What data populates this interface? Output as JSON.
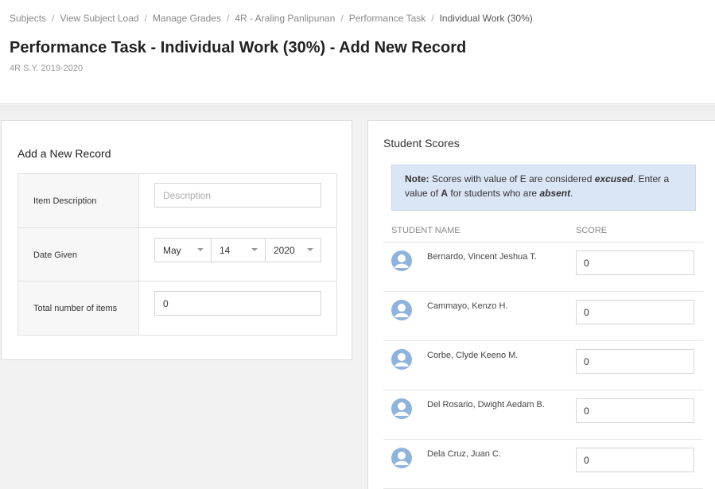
{
  "breadcrumb": [
    {
      "label": "Subjects"
    },
    {
      "label": "View Subject Load"
    },
    {
      "label": "Manage Grades"
    },
    {
      "label": "4R - Araling Panlipunan"
    },
    {
      "label": "Performance Task"
    },
    {
      "label": "Individual Work (30%)"
    }
  ],
  "page": {
    "title": "Performance Task - Individual Work (30%) - Add New Record",
    "subtitle": "4R S.Y. 2019-2020"
  },
  "form": {
    "title": "Add a New Record",
    "item_description": {
      "label": "Item Description",
      "placeholder": "Description",
      "value": ""
    },
    "date_given": {
      "label": "Date Given",
      "month": "May",
      "day": "14",
      "year": "2020"
    },
    "total_items": {
      "label": "Total number of items",
      "value": "0"
    }
  },
  "scores": {
    "title": "Student Scores",
    "note": {
      "prefix": "Note:",
      "text1": " Scores with value of E are considered ",
      "excused": "excused",
      "text2": ". Enter a value of ",
      "a": "A",
      "text3": " for students who are ",
      "absent": "absent",
      "text4": "."
    },
    "columns": {
      "name": "STUDENT NAME",
      "score": "SCORE"
    },
    "students": [
      {
        "name": "Bernardo, Vincent Jeshua T.",
        "score": "0"
      },
      {
        "name": "Cammayo, Kenzo H.",
        "score": "0"
      },
      {
        "name": "Corbe, Clyde Keeno M.",
        "score": "0"
      },
      {
        "name": "Del Rosario, Dwight Aedam B.",
        "score": "0"
      },
      {
        "name": "Dela Cruz, Juan C.",
        "score": "0"
      }
    ]
  },
  "colors": {
    "note_bg": "#dae6f6",
    "avatar": "#8fb3dc"
  },
  "icons": {
    "avatar": "user-avatar-icon",
    "dropdown": "caret-down-icon"
  }
}
